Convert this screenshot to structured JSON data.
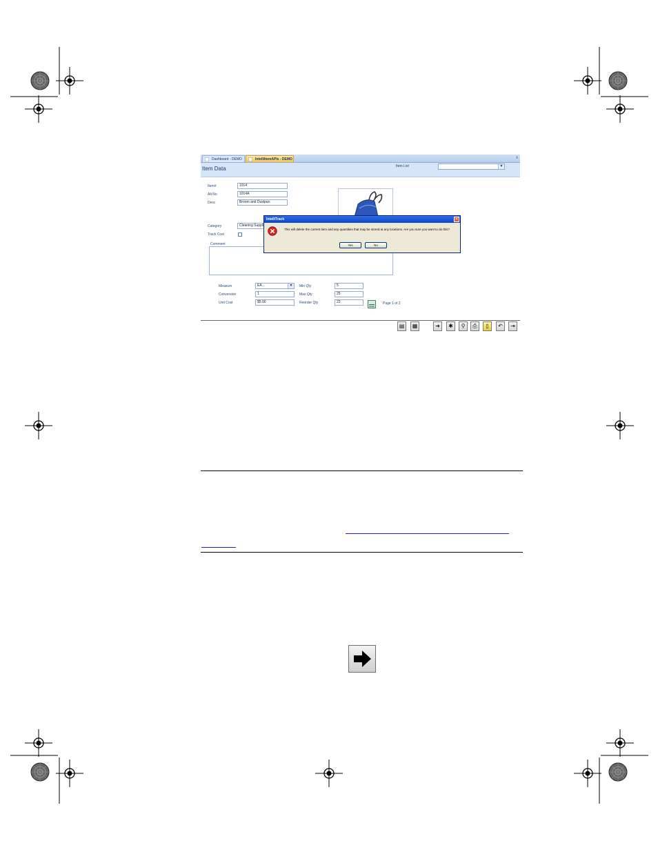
{
  "app": {
    "tabs": [
      {
        "label": "Dashboard - DEMO"
      },
      {
        "label": "IntelliItemAPIs - DEMO"
      }
    ],
    "close_glyph": "x",
    "page_title": "Item Data",
    "item_list_label": "Item List",
    "item_list_value": ""
  },
  "form": {
    "item_label": "Item#",
    "item_value": "1014",
    "altno_label": "Alt No",
    "altno_value": "1014A",
    "desc_label": "Desc",
    "desc_value": "Broom and Dustpan",
    "category_label": "Category",
    "category_value": "Cleaning Supplies",
    "trackcost_label": "Track Cost",
    "comment_label": "Comment",
    "measure_label": "Measure",
    "measure_value": "EA",
    "conversion_label": "Conversion",
    "conversion_value": "1",
    "unitcost_label": "Unit Cost",
    "unitcost_value": "$5.00",
    "minqty_label": "Min Qty",
    "minqty_value": "5",
    "maxqty_label": "Max Qty",
    "maxqty_value": "25",
    "reorderqty_label": "Reorder Qty",
    "reorderqty_value": "23",
    "page_info": "Page 1 of 2"
  },
  "dialog": {
    "title": "IntelliTrack",
    "message": "This will delete the current item and any quantities that may be stored at any locations. Are you sure you want to do this?",
    "yes_label": "Yes",
    "no_label": "No"
  },
  "toolbar": {
    "icons": [
      "copy-record-icon",
      "calculator-icon",
      "next-arrow-icon",
      "new-record-icon",
      "find-icon",
      "print-icon",
      "delete-icon",
      "undo-icon",
      "exit-icon"
    ]
  },
  "colors": {
    "header_bg": "#d6e5f8",
    "dialog_title": "#0a47c6",
    "active_tab": "#f6c857"
  }
}
